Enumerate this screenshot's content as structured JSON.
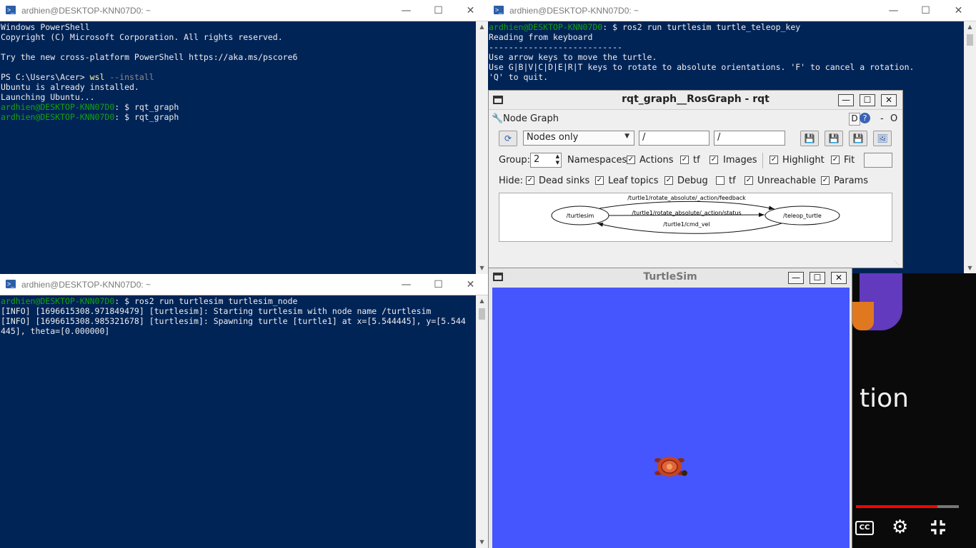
{
  "windows": {
    "ps_top_left": {
      "title": "ardhien@DESKTOP-KNN07D0: ~",
      "lines": [
        {
          "segments": [
            {
              "text": "Windows PowerShell",
              "c": ""
            }
          ]
        },
        {
          "segments": [
            {
              "text": "Copyright (C) Microsoft Corporation. All rights reserved.",
              "c": ""
            }
          ]
        },
        {
          "segments": [
            {
              "text": "",
              "c": ""
            }
          ]
        },
        {
          "segments": [
            {
              "text": "Try the new cross-platform PowerShell https://aka.ms/pscore6",
              "c": ""
            }
          ]
        },
        {
          "segments": [
            {
              "text": "",
              "c": ""
            }
          ]
        },
        {
          "segments": [
            {
              "text": "PS C:\\Users\\Acer> ",
              "c": ""
            },
            {
              "text": "wsl",
              "c": "yellow"
            },
            {
              "text": " --install",
              "c": "gray"
            }
          ]
        },
        {
          "segments": [
            {
              "text": "Ubuntu is already installed.",
              "c": ""
            }
          ]
        },
        {
          "segments": [
            {
              "text": "Launching Ubuntu...",
              "c": ""
            }
          ]
        },
        {
          "segments": [
            {
              "text": "ardhien@DESKTOP-KNN07D0",
              "c": "green"
            },
            {
              "text": ": $ rqt_graph",
              "c": ""
            }
          ]
        },
        {
          "segments": [
            {
              "text": "ardhien@DESKTOP-KNN07D0",
              "c": "green"
            },
            {
              "text": ": $ rqt_graph",
              "c": ""
            }
          ]
        }
      ]
    },
    "ps_top_right": {
      "title": "ardhien@DESKTOP-KNN07D0: ~",
      "lines": [
        {
          "segments": [
            {
              "text": "ardhien@DESKTOP-KNN07D0",
              "c": "green"
            },
            {
              "text": ": $ ros2 run turtlesim turtle_teleop_key",
              "c": ""
            }
          ]
        },
        {
          "segments": [
            {
              "text": "Reading from keyboard",
              "c": ""
            }
          ]
        },
        {
          "segments": [
            {
              "text": "---------------------------",
              "c": ""
            }
          ]
        },
        {
          "segments": [
            {
              "text": "Use arrow keys to move the turtle.",
              "c": ""
            }
          ]
        },
        {
          "segments": [
            {
              "text": "Use G|B|V|C|D|E|R|T keys to rotate to absolute orientations. 'F' to cancel a rotation.",
              "c": ""
            }
          ]
        },
        {
          "segments": [
            {
              "text": "'Q' to quit.",
              "c": ""
            }
          ]
        }
      ]
    },
    "ps_bottom_left": {
      "title": "ardhien@DESKTOP-KNN07D0: ~",
      "lines": [
        {
          "segments": [
            {
              "text": "ardhien@DESKTOP-KNN07D0",
              "c": "green"
            },
            {
              "text": ": $ ros2 run turtlesim turtlesim_node",
              "c": ""
            }
          ]
        },
        {
          "segments": [
            {
              "text": "[INFO] [1696615308.971849479] [turtlesim]: Starting turtlesim with node name /turtlesim",
              "c": ""
            }
          ]
        },
        {
          "segments": [
            {
              "text": "[INFO] [1696615308.985321678] [turtlesim]: Spawning turtle [turtle1] at x=[5.544445], y=[5.544",
              "c": ""
            }
          ]
        },
        {
          "segments": [
            {
              "text": "445], theta=[0.000000]",
              "c": ""
            }
          ]
        }
      ]
    }
  },
  "rqt": {
    "title": "rqt_graph__RosGraph - rqt",
    "plugin_label": "Node Graph",
    "plugin_right": "D",
    "plugin_dash": "-",
    "plugin_o": "O",
    "filter_mode": "Nodes only",
    "ns_filter": "/",
    "topic_filter": "/",
    "group_label": "Group:",
    "group_value": "2",
    "namespaces_label": "Namespaces",
    "actions_label": "Actions",
    "tf_label": "tf",
    "images_label": "Images",
    "highlight_label": "Highlight",
    "fit_label": "Fit",
    "hide_label": "Hide:",
    "dead_sinks_label": "Dead sinks",
    "leaf_topics_label": "Leaf topics",
    "debug_label": "Debug",
    "hide_tf_label": "tf",
    "unreachable_label": "Unreachable",
    "params_label": "Params",
    "graph": {
      "node_left": "/turtlesim",
      "node_right": "/teleop_turtle",
      "edge_top": "/turtle1/rotate_absolute/_action/feedback",
      "edge_mid": "/turtle1/rotate_absolute/_action/status",
      "edge_bottom": "/turtle1/cmd_vel"
    }
  },
  "turtlesim": {
    "title": "TurtleSim",
    "background": "#4556ff"
  },
  "video": {
    "partial_text": "tion",
    "progress_fraction": 0.79
  }
}
